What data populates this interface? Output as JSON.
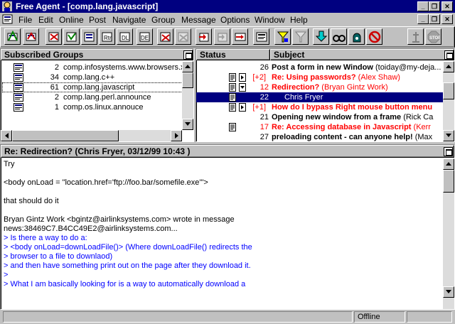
{
  "window": {
    "title": "Free Agent - [comp.lang.javascript]"
  },
  "menu": [
    "File",
    "Edit",
    "Online",
    "Post",
    "Navigate",
    "Group",
    "Message",
    "Options",
    "Window",
    "Help"
  ],
  "groups_pane": {
    "header": "Subscribed Groups",
    "rows": [
      {
        "count": "2",
        "name": "comp.infosystems.www.browsers.x"
      },
      {
        "count": "34",
        "name": "comp.lang.c++"
      },
      {
        "count": "61",
        "name": "comp.lang.javascript"
      },
      {
        "count": "2",
        "name": "comp.lang.perl.announce"
      },
      {
        "count": "1",
        "name": "comp.os.linux.annouce"
      }
    ]
  },
  "messages_pane": {
    "status_header": "Status",
    "subject_header": "Subject",
    "rows": [
      {
        "count": "26",
        "subject": "Post a form in new Window",
        "author": "(toiday@my-deja..."
      },
      {
        "count": "[+2]",
        "subject": "Re: Using passwords?",
        "author": "(Alex Shaw)"
      },
      {
        "count": "12",
        "subject": "Redirection?",
        "author": "(Bryan Gintz Work)"
      },
      {
        "count": "22",
        "subject": "Chris Fryer",
        "author": ""
      },
      {
        "count": "[+1]",
        "subject": "How do I bypass Right mouse button menu",
        "author": ""
      },
      {
        "count": "21",
        "subject": "Opening new window from a frame",
        "author": "(Rick Ca"
      },
      {
        "count": "17",
        "subject": "Re: Accessing database in Javascript",
        "author": "(Kerr"
      },
      {
        "count": "27",
        "subject": "preloading content - can anyone help!",
        "author": "(Max"
      }
    ]
  },
  "message_view": {
    "header": "Re: Redirection? (Chris Fryer, 03/12/99 10:43 )",
    "lines": [
      "Try",
      "",
      "<body onLoad = \"location.href='ftp://foo.bar/somefile.exe'\">",
      "",
      "that should do it",
      "",
      "Bryan Gintz Work <bgintz@airlinksystems.com> wrote in message",
      "news:38469C7.B4CC49E2@airlinksystems.com...",
      "> Is there a way to do a:",
      "> <body onLoad=downLoadFile()>  (Where downLoadFile() redirects the",
      "> browser to a file to downlaod)",
      "> and then have something print out on the page after they download it.",
      ">",
      "> What I am basically looking for is a way to automatically download a"
    ]
  },
  "status_bar": {
    "mode": "Offline"
  },
  "colors": {
    "titlebar": "#000080",
    "unread_red": "#ff0000",
    "quote_blue": "#0000ff",
    "selection": "#000080"
  },
  "toolbar_icons": [
    "get-new-headers-icon",
    "get-all-headers-icon",
    "retrieve-icon",
    "mark-retrieve-icon",
    "get-bodies-icon",
    "delete-icon",
    "purge-icon",
    "post-new-icon",
    "post-reply-icon",
    "reply-email-icon",
    "view-raw-icon",
    "filter-icon",
    "skip-icon",
    "next-unread-icon",
    "find-icon",
    "watch-icon",
    "ignore-icon",
    "online-icon",
    "stop-icon"
  ]
}
